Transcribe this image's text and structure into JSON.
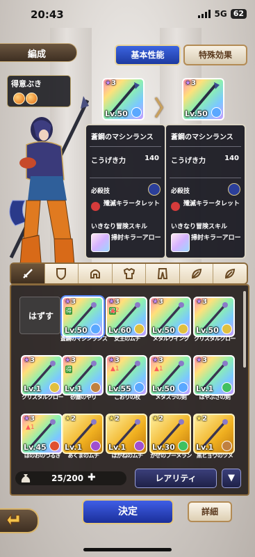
{
  "status": {
    "time": "20:43",
    "network": "5G",
    "battery": "62"
  },
  "header": {
    "title": "編成",
    "tab_basic": "基本性能",
    "tab_special": "特殊効果"
  },
  "skill_box": {
    "label": "得意ぶき"
  },
  "current": {
    "stars": "3",
    "level": "Lv.50"
  },
  "preview": {
    "stars": "3",
    "level": "Lv.50"
  },
  "panel_left": {
    "name": "蒼鋼のマシンランス",
    "attack_label": "こうげき力",
    "attack_value": "140",
    "special_label": "必殺技",
    "special_name": "殲滅キラータレット",
    "sub_label": "いきなり冒険スキル",
    "sub_name": "掃討キラーアロー"
  },
  "panel_right": {
    "name": "蒼鋼のマシンランス",
    "attack_label": "こうげき力",
    "attack_value": "140",
    "special_label": "必殺技",
    "special_name": "殲滅キラータレット",
    "sub_label": "いきなり冒険スキル",
    "sub_name": "掃討キラーアロー"
  },
  "categories": [
    "sword-icon",
    "shield-icon",
    "helmet-icon",
    "armor-icon",
    "pants-icon",
    "accessory-icon",
    "accessory2-icon"
  ],
  "inventory": {
    "unequip": "はずす",
    "items": [
      {
        "name": "蒼鋼のマシンランス",
        "stars": "3",
        "level": "Lv.50",
        "rainbow": true,
        "element": "#5aa8ff",
        "tag": "得"
      },
      {
        "name": "女王のムチ",
        "stars": "3",
        "level": "Lv.60",
        "rainbow": true,
        "element": "#e0c040",
        "tag": "得",
        "plus": "2"
      },
      {
        "name": "メタルウイング",
        "stars": "3",
        "level": "Lv.50",
        "rainbow": true,
        "element": "#e0c040"
      },
      {
        "name": "クリスタルクロー",
        "stars": "3",
        "level": "Lv.50",
        "rainbow": true,
        "element": "#e0c040"
      },
      {
        "name": "クリスタルクロー",
        "stars": "3",
        "level": "Lv.1",
        "rainbow": true,
        "element": "#e0c040"
      },
      {
        "name": "砂塵のやり",
        "stars": "3",
        "level": "Lv.1",
        "rainbow": true,
        "element": "#c08040",
        "tag": "得"
      },
      {
        "name": "こおりの杖",
        "stars": "3",
        "level": "Lv.55",
        "rainbow": true,
        "element": "#5aa8ff",
        "plus": "1"
      },
      {
        "name": "メタスラの剣",
        "stars": "3",
        "level": "Lv.50",
        "rainbow": true,
        "element": "#5aa8ff",
        "plus": "1"
      },
      {
        "name": "はやぶさの剣",
        "stars": "3",
        "level": "Lv.1",
        "rainbow": true,
        "element": "#40c060"
      },
      {
        "name": "ほのおのつるぎ",
        "stars": "3",
        "level": "Lv.45",
        "rainbow": true,
        "element": "#e05030",
        "plus": "1"
      },
      {
        "name": "あくまのムチ",
        "stars": "2",
        "level": "Lv.1",
        "rainbow": false,
        "element": "#a050d0"
      },
      {
        "name": "はがねのムチ",
        "stars": "2",
        "level": "Lv.1",
        "rainbow": false,
        "element": "#a050d0"
      },
      {
        "name": "かぜのブーメラン",
        "stars": "2",
        "level": "Lv.30",
        "rainbow": false,
        "element": "#40c060"
      },
      {
        "name": "黒ヒョウのツメ",
        "stars": "2",
        "level": "Lv.1",
        "rainbow": false,
        "element": "#c08040"
      }
    ]
  },
  "footer": {
    "capacity": "25/200",
    "sort": "レアリティ",
    "confirm": "決定",
    "detail": "詳細"
  }
}
